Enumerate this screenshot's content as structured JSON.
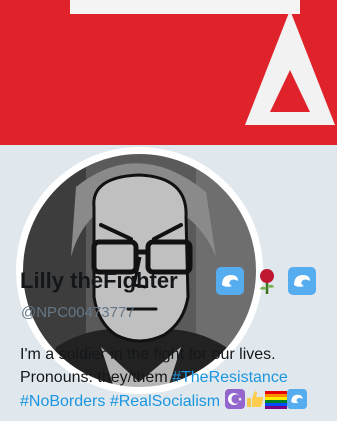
{
  "profile": {
    "display_name": "Lilly theFighter",
    "handle": "@NPC00473777",
    "bio_line1": "I'm a soldier in the fight for our lives.",
    "bio_line2_text": "Pronouns: they/them ",
    "hashtags": [
      "#TheResistance",
      "#NoBorders",
      "#RealSocialism"
    ],
    "name_emojis": [
      "wave-icon",
      "rose-icon",
      "wave-icon"
    ],
    "bio_emojis": [
      "crescent-star-icon",
      "thumbs-up-icon",
      "rainbow-flag-icon",
      "wave-icon"
    ]
  },
  "colors": {
    "banner_red": "#e0232a",
    "card_background": "#e1e8ed",
    "hashtag_blue": "#1b95e0",
    "handle_gray": "#657786",
    "text_dark": "#14171a"
  }
}
